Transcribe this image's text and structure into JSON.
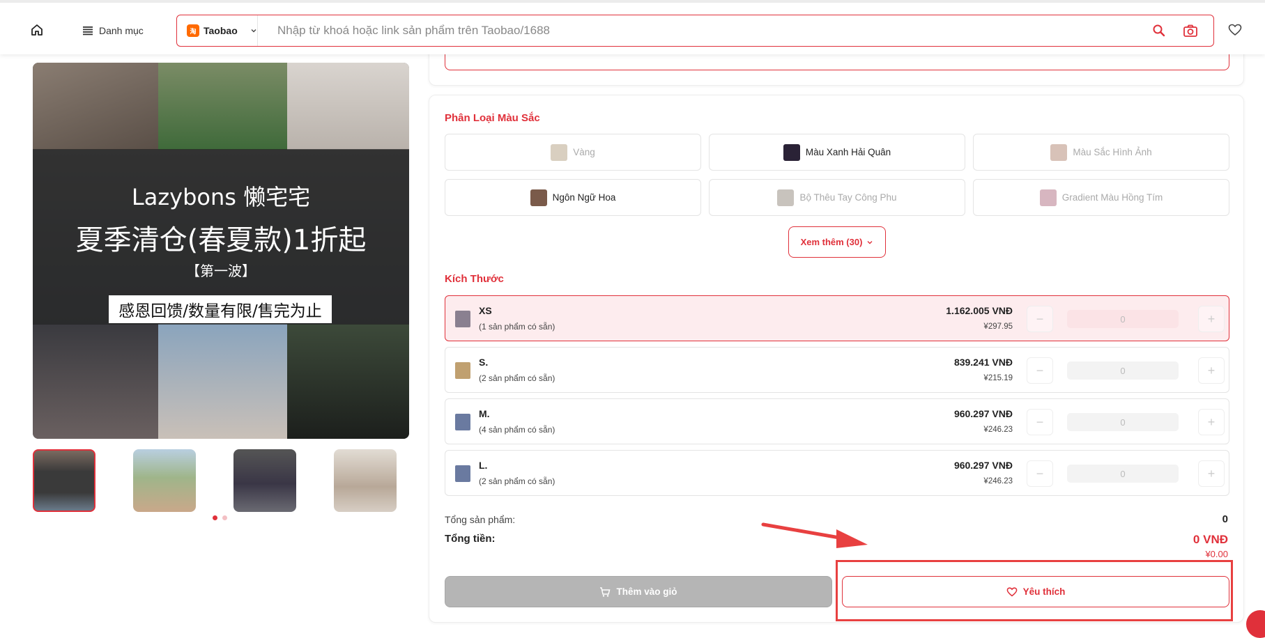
{
  "header": {
    "menu_label": "Danh mục",
    "source_label": "Taobao",
    "search_placeholder": "Nhập từ khoá hoặc link sản phẩm trên Taobao/1688"
  },
  "banner": {
    "brand": "Lazybons 懒宅宅",
    "headline": "夏季清仓(春夏款)1折起",
    "sub": "【第一波】",
    "tagline": "感恩回馈/数量有限/售完为止"
  },
  "color_section": {
    "title": "Phân Loại Màu Sắc",
    "options": [
      {
        "label": "Vàng",
        "available": false,
        "swatch": "#d9cfc0"
      },
      {
        "label": "Màu Xanh Hải Quân",
        "available": true,
        "swatch": "#2a2236"
      },
      {
        "label": "Màu Sắc Hình Ảnh",
        "available": false,
        "swatch": "#d8c2b8"
      },
      {
        "label": "Ngôn Ngữ Hoa",
        "available": true,
        "swatch": "#7a5a4a"
      },
      {
        "label": "Bộ Thêu Tay Công Phu",
        "available": false,
        "swatch": "#c8c3bd"
      },
      {
        "label": "Gradient Màu Hồng Tím",
        "available": false,
        "swatch": "#d7b6c0"
      }
    ],
    "more_label": "Xem thêm (30)"
  },
  "size_section": {
    "title": "Kích Thước",
    "rows": [
      {
        "name": "XS",
        "stock": "(1 sản phẩm có sẵn)",
        "vnd": "1.162.005 VNĐ",
        "cny": "¥297.95",
        "qty": "0",
        "selected": true
      },
      {
        "name": "S.",
        "stock": "(2 sản phẩm có sẵn)",
        "vnd": "839.241 VNĐ",
        "cny": "¥215.19",
        "qty": "0",
        "selected": false
      },
      {
        "name": "M.",
        "stock": "(4 sản phẩm có sẵn)",
        "vnd": "960.297 VNĐ",
        "cny": "¥246.23",
        "qty": "0",
        "selected": false
      },
      {
        "name": "L.",
        "stock": "(2 sản phẩm có sẵn)",
        "vnd": "960.297 VNĐ",
        "cny": "¥246.23",
        "qty": "0",
        "selected": false
      }
    ]
  },
  "summary": {
    "count_label": "Tổng sản phẩm:",
    "count_value": "0",
    "total_label": "Tổng tiền:",
    "total_vnd": "0 VNĐ",
    "total_cny": "¥0.00"
  },
  "actions": {
    "add_cart": "Thêm vào giỏ",
    "wishlist": "Yêu thích"
  },
  "colors": {
    "accent": "#e0303a",
    "annotation": "#e84040"
  }
}
